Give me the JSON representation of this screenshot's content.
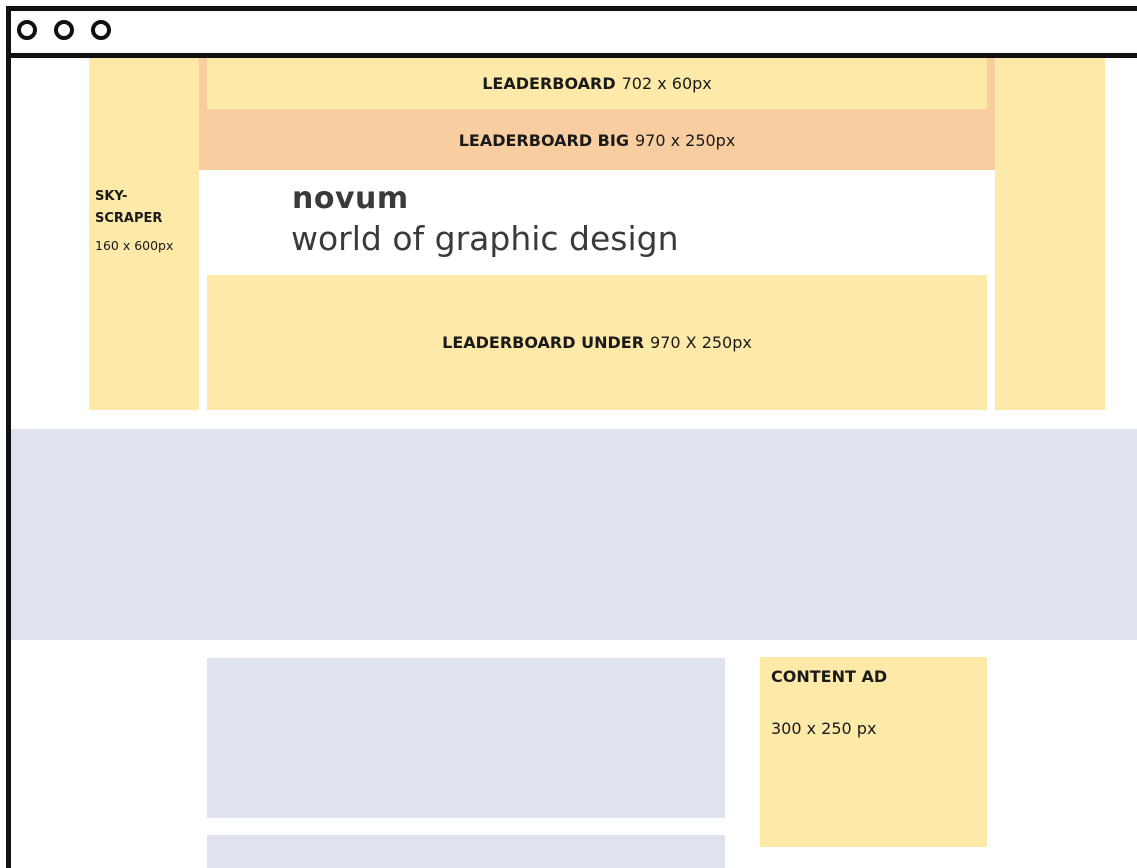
{
  "window": {
    "controls": [
      "window-control-circle",
      "window-control-circle",
      "window-control-circle"
    ]
  },
  "ads": {
    "leaderboard": {
      "name": "LEADERBOARD",
      "size": "702 x 60px"
    },
    "leaderboard_big": {
      "name": "LEADERBOARD BIG",
      "size": "970 x 250px"
    },
    "skyscraper": {
      "name_line1": "SKY-",
      "name_line2": "SCRAPER",
      "size": "160 x 600px"
    },
    "leaderboard_under": {
      "name": "LEADERBOARD UNDER",
      "size": "970 X 250px"
    },
    "content_ad": {
      "name": "CONTENT AD",
      "size": "300 x 250 px"
    }
  },
  "logo": {
    "title": "novum",
    "subtitle": "world of graphic design"
  },
  "colors": {
    "ad_yellow": "#fde9a8",
    "ad_peach": "#f8cea0",
    "content_grey": "#e0e2ee",
    "frame": "#111111"
  }
}
